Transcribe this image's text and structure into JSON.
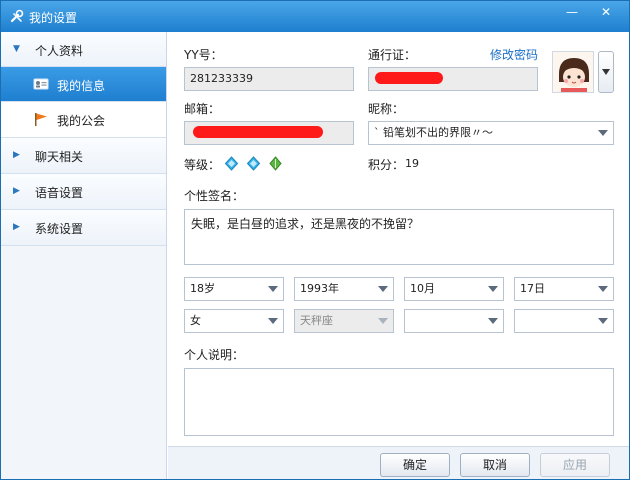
{
  "window": {
    "title": "我的设置",
    "minimize": "—",
    "close": "✕"
  },
  "sidebar": {
    "groups": [
      {
        "label": "个人资料",
        "expanded": true
      },
      {
        "label": "聊天相关",
        "expanded": false
      },
      {
        "label": "语音设置",
        "expanded": false
      },
      {
        "label": "系统设置",
        "expanded": false
      }
    ],
    "items": [
      {
        "label": "我的信息",
        "active": true,
        "icon": "id-card-icon"
      },
      {
        "label": "我的公会",
        "active": false,
        "icon": "flag-icon"
      }
    ]
  },
  "profile": {
    "yy_label": "YY号：",
    "yy_value": "281233339",
    "passport_label": "通行证：",
    "change_password": "修改密码",
    "email_label": "邮箱：",
    "nickname_label": "昵称：",
    "nickname_value": "ˋ  铅笔划不出的界限〃～",
    "level_label": "等级：",
    "points_label": "积分：",
    "points_value": "19",
    "signature_label": "个性签名：",
    "signature_value": "失眠，是白昼的追求，还是黑夜的不挽留？",
    "age": "18岁",
    "year": "1993年",
    "month": "10月",
    "day": "17日",
    "gender": "女",
    "zodiac": "天秤座",
    "province": "",
    "city": "",
    "description_label": "个人说明：",
    "description_value": ""
  },
  "buttons": {
    "ok": "确定",
    "cancel": "取消",
    "apply": "应用"
  },
  "colors": {
    "accent": "#1e7fcf",
    "redaction": "#ff1a1a",
    "link": "#1b6fc8"
  }
}
